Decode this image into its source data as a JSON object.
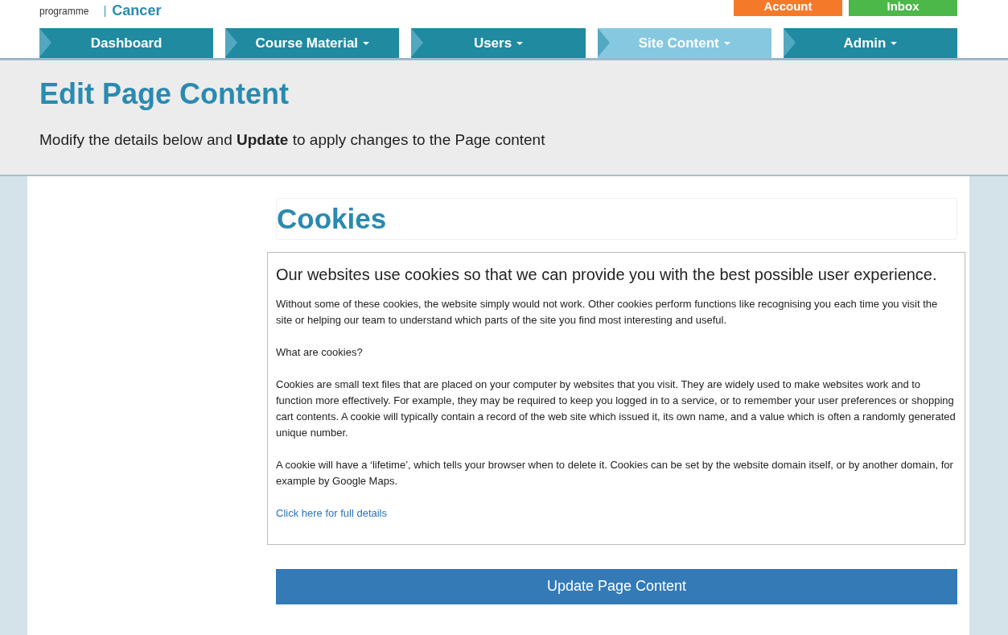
{
  "header": {
    "logo_text": "programme",
    "site_name": "Cancer",
    "buttons": [
      {
        "label": "Account",
        "color": "#f47a2a"
      },
      {
        "label": "Inbox",
        "color": "#4cb849"
      }
    ]
  },
  "nav": [
    {
      "label": "Dashboard",
      "dropdown": false,
      "selected": false
    },
    {
      "label": "Course Material",
      "dropdown": true,
      "selected": false
    },
    {
      "label": "Users",
      "dropdown": true,
      "selected": false
    },
    {
      "label": "Site Content",
      "dropdown": true,
      "selected": true
    },
    {
      "label": "Admin",
      "dropdown": true,
      "selected": false
    }
  ],
  "page": {
    "title": "Edit Page Content",
    "subtitle": "Modify the details below and **Update** to apply changes to the Page content"
  },
  "form": {
    "heading": "Cookies",
    "editor": [
      {
        "kind": "lead",
        "text": "Our websites use cookies so that we can provide you with the best possible user experience."
      },
      {
        "kind": "paragraph",
        "text": "Without some of these cookies, the website simply would not work. Other cookies perform functions like recognising you each time you visit the site or helping our team to understand which parts of the site you find most interesting and useful."
      },
      {
        "kind": "paragraph",
        "text": "What are cookies?"
      },
      {
        "kind": "paragraph",
        "text": "Cookies are small text files that are placed on your computer by websites that you visit. They are widely used to make websites work and to function more effectively. For example, they may be required to keep you logged in to a service, or to remember your user preferences or shopping cart contents. A cookie will typically contain a record of the web site which issued it, its own name, and a value which is often a randomly generated unique number."
      },
      {
        "kind": "paragraph",
        "text": "A cookie will have a ‘lifetime’, which tells your browser when to delete it. Cookies can be set by the website domain itself, or by another domain, for example by Google Maps."
      },
      {
        "kind": "link",
        "text": "Click here for full details"
      }
    ],
    "submit": "Update Page Content"
  }
}
